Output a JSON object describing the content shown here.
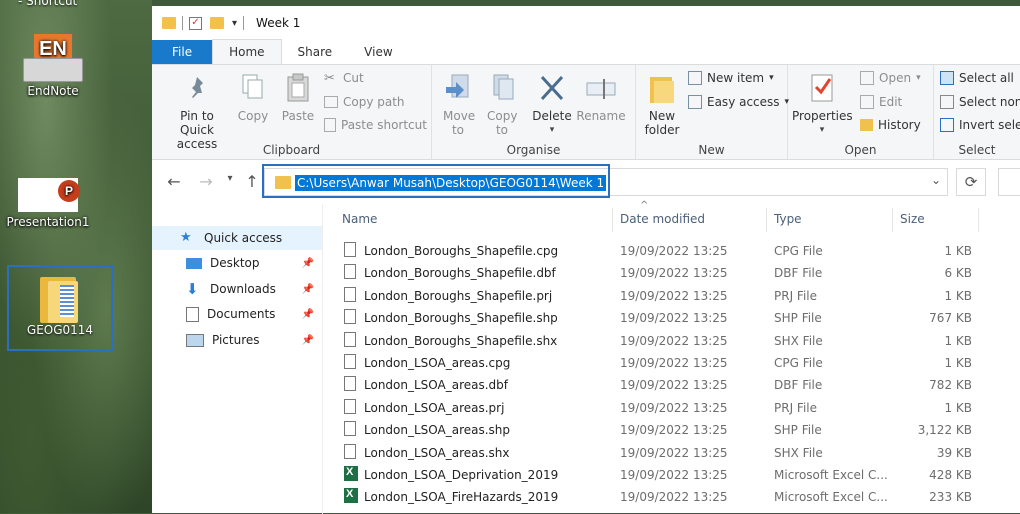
{
  "desktop": {
    "shortcut_caption": "- Shortcut",
    "icons": [
      {
        "label": "EndNote",
        "logo_text": "EN"
      },
      {
        "label": "Presentation1",
        "logo_text": "P"
      },
      {
        "label": "GEOG0114"
      }
    ]
  },
  "titlebar": {
    "title": "Week 1"
  },
  "tabs": [
    {
      "label": "File"
    },
    {
      "label": "Home"
    },
    {
      "label": "Share"
    },
    {
      "label": "View"
    }
  ],
  "ribbon": {
    "clipboard": {
      "label": "Clipboard",
      "pin": "Pin to Quick access",
      "copy": "Copy",
      "paste": "Paste",
      "cut": "Cut",
      "copy_path": "Copy path",
      "paste_shortcut": "Paste shortcut"
    },
    "organise": {
      "label": "Organise",
      "move_to": "Move to",
      "copy_to": "Copy to",
      "delete": "Delete",
      "rename": "Rename"
    },
    "new": {
      "label": "New",
      "new_folder": "New folder",
      "new_item": "New item",
      "easy_access": "Easy access"
    },
    "open": {
      "label": "Open",
      "properties": "Properties",
      "open": "Open",
      "edit": "Edit",
      "history": "History"
    },
    "select": {
      "label": "Select",
      "select_all": "Select all",
      "select_none": "Select none",
      "invert": "Invert selection"
    }
  },
  "address": {
    "path": "C:\\Users\\Anwar Musah\\Desktop\\GEOG0114\\Week 1"
  },
  "nav": [
    {
      "label": "Quick access"
    },
    {
      "label": "Desktop"
    },
    {
      "label": "Downloads"
    },
    {
      "label": "Documents"
    },
    {
      "label": "Pictures"
    }
  ],
  "columns": {
    "name": "Name",
    "date": "Date modified",
    "type": "Type",
    "size": "Size"
  },
  "files": [
    {
      "name": "London_Boroughs_Shapefile.cpg",
      "date": "19/09/2022 13:25",
      "type": "CPG File",
      "size": "1 KB",
      "icon": "file-icon"
    },
    {
      "name": "London_Boroughs_Shapefile.dbf",
      "date": "19/09/2022 13:25",
      "type": "DBF File",
      "size": "6 KB",
      "icon": "file-icon"
    },
    {
      "name": "London_Boroughs_Shapefile.prj",
      "date": "19/09/2022 13:25",
      "type": "PRJ File",
      "size": "1 KB",
      "icon": "file-icon"
    },
    {
      "name": "London_Boroughs_Shapefile.shp",
      "date": "19/09/2022 13:25",
      "type": "SHP File",
      "size": "767 KB",
      "icon": "file-icon"
    },
    {
      "name": "London_Boroughs_Shapefile.shx",
      "date": "19/09/2022 13:25",
      "type": "SHX File",
      "size": "1 KB",
      "icon": "file-icon"
    },
    {
      "name": "London_LSOA_areas.cpg",
      "date": "19/09/2022 13:25",
      "type": "CPG File",
      "size": "1 KB",
      "icon": "file-icon"
    },
    {
      "name": "London_LSOA_areas.dbf",
      "date": "19/09/2022 13:25",
      "type": "DBF File",
      "size": "782 KB",
      "icon": "file-icon"
    },
    {
      "name": "London_LSOA_areas.prj",
      "date": "19/09/2022 13:25",
      "type": "PRJ File",
      "size": "1 KB",
      "icon": "file-icon"
    },
    {
      "name": "London_LSOA_areas.shp",
      "date": "19/09/2022 13:25",
      "type": "SHP File",
      "size": "3,122 KB",
      "icon": "file-icon"
    },
    {
      "name": "London_LSOA_areas.shx",
      "date": "19/09/2022 13:25",
      "type": "SHX File",
      "size": "39 KB",
      "icon": "file-icon"
    },
    {
      "name": "London_LSOA_Deprivation_2019",
      "date": "19/09/2022 13:25",
      "type": "Microsoft Excel C...",
      "size": "428 KB",
      "icon": "excel-icon"
    },
    {
      "name": "London_LSOA_FireHazards_2019",
      "date": "19/09/2022 13:25",
      "type": "Microsoft Excel C...",
      "size": "233 KB",
      "icon": "excel-icon"
    }
  ],
  "colors": {
    "accent": "#0078d7",
    "file_tab": "#1979ca",
    "highlight_box": "#2b6fc2"
  }
}
